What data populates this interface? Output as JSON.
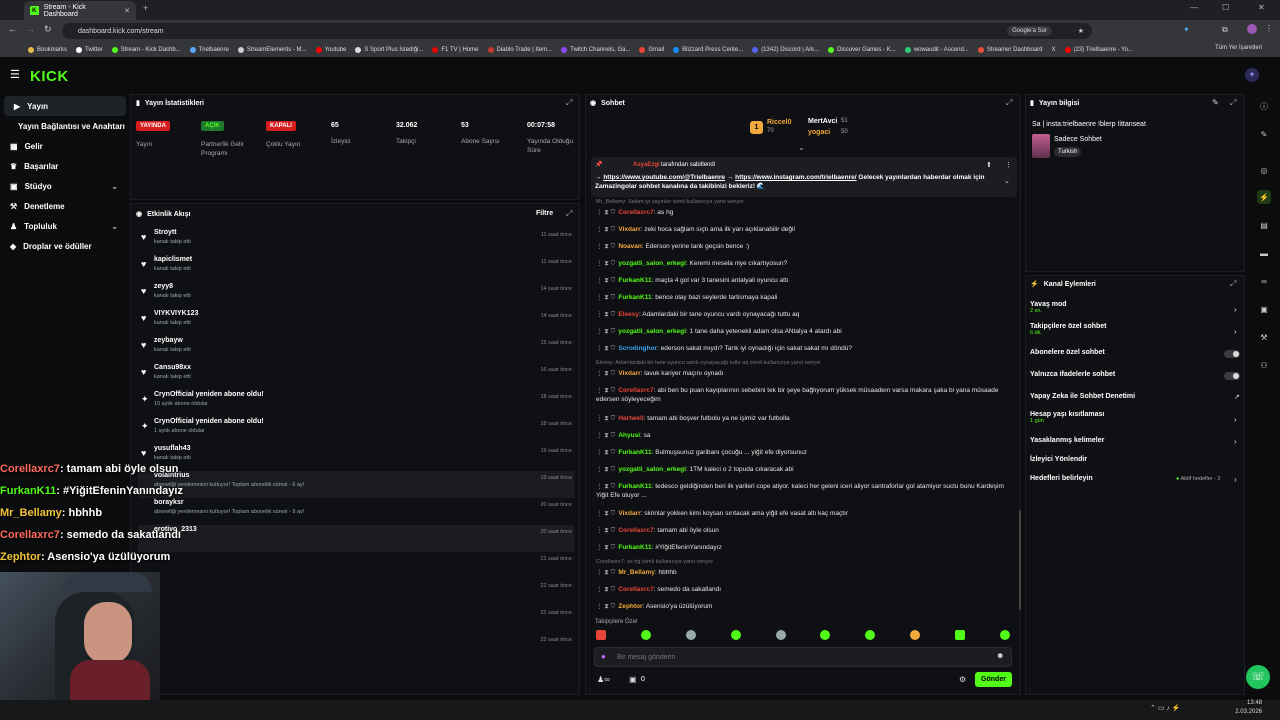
{
  "browser": {
    "tab_title": "Stream - Kick Dashboard",
    "url": "dashboard.kick.com/stream",
    "google_btn": "Google'a Sor",
    "bookmarks": [
      "Bookmarks",
      "Twitter",
      "Stream - Kick Dashb...",
      "Trielbaenre",
      "StreamElements - M...",
      "Youtube",
      "S Sport Plus İstediği...",
      "F1 TV | Home",
      "Diablo Trade | Item...",
      "Twitch Channels, Ga...",
      "Gmail",
      "Blizzard Press Cente...",
      "(1342) Discord | Ark...",
      "Discover Games - K...",
      "wowaudit - Ascend...",
      "Streamer Dashboard",
      "X",
      "(23) Trielbaenre - Yo..."
    ],
    "all_bookmarks": "Tüm Yer İşaretleri"
  },
  "brand": {
    "logo": "KICK"
  },
  "nav": {
    "items": [
      {
        "label": "Yayın",
        "chev": ""
      },
      {
        "label": "Yayın Bağlantısı ve Anahtarı",
        "chev": ""
      },
      {
        "label": "Gelir",
        "chev": ""
      },
      {
        "label": "Başarılar",
        "chev": ""
      },
      {
        "label": "Stüdyo",
        "chev": "⌄"
      },
      {
        "label": "Denetleme",
        "chev": ""
      },
      {
        "label": "Topluluk",
        "chev": "⌄"
      },
      {
        "label": "Droplar ve ödüller",
        "chev": ""
      }
    ]
  },
  "stats": {
    "title": "Yayın İstatistikleri",
    "items": [
      {
        "value": "YAYINDA",
        "label": "Yayın"
      },
      {
        "value": "AÇIK",
        "label": "Partnerlik Gelir Programı"
      },
      {
        "value": "KAPALI",
        "label": "Çoklu Yayın"
      },
      {
        "value": "65",
        "label": "İzleyici"
      },
      {
        "value": "32.062",
        "label": "Takipçi"
      },
      {
        "value": "53",
        "label": "Abone Sayısı"
      },
      {
        "value": "00:07:58",
        "label": "Yayında Olduğu Süre"
      }
    ]
  },
  "activity": {
    "title": "Etkinlik Akışı",
    "filter": "Filtre",
    "items": [
      {
        "icon": "♥",
        "name": "Stroytt",
        "sub": "kanalı takip etti",
        "time": "11 saat önce"
      },
      {
        "icon": "♥",
        "name": "kapiclismet",
        "sub": "kanalı takip etti",
        "time": "11 saat önce"
      },
      {
        "icon": "♥",
        "name": "zeyy8",
        "sub": "kanalı takip etti",
        "time": "14 saat önce"
      },
      {
        "icon": "♥",
        "name": "VIYKVIYK123",
        "sub": "kanalı takip etti",
        "time": "14 saat önce"
      },
      {
        "icon": "♥",
        "name": "zeybayw",
        "sub": "kanalı takip etti",
        "time": "15 saat önce"
      },
      {
        "icon": "♥",
        "name": "Cansu98xx",
        "sub": "kanalı takip etti",
        "time": "16 saat önce"
      },
      {
        "icon": "✦",
        "name": "CrynOfficial yeniden abone oldu!",
        "sub": "10 aylık abone oldular",
        "time": "18 saat önce"
      },
      {
        "icon": "✦",
        "name": "CrynOfficial yeniden abone oldu!",
        "sub": "1 aylık abone oldular",
        "time": "18 saat önce"
      },
      {
        "icon": "♥",
        "name": "yusuflah43",
        "sub": "kanalı takip etti",
        "time": "19 saat önce"
      },
      {
        "icon": "",
        "name": "volaintrius",
        "sub": "aboneliği yenilemesini kutluyor! Toplam abonelik süresi - 6 ay!",
        "time": "19 saat önce"
      },
      {
        "icon": "",
        "name": "borayksr",
        "sub": "aboneliği yenilemesini kutluyor! Toplam abonelik süresi - 9 ay!",
        "time": "20 saat önce"
      },
      {
        "icon": "",
        "name": "erotivo_2313",
        "sub": "",
        "time": "20 saat önce"
      },
      {
        "icon": "",
        "name": "",
        "sub": "",
        "time": "21 saat önce"
      },
      {
        "icon": "",
        "name": "",
        "sub": "",
        "time": "22 saat önce"
      },
      {
        "icon": "",
        "name": "",
        "sub": "",
        "time": "22 saat önce"
      },
      {
        "icon": "",
        "name": "",
        "sub": "",
        "time": "22 saat önce"
      }
    ]
  },
  "chat": {
    "title": "Sohbet",
    "top": [
      {
        "name": "Riccel0",
        "count": "70"
      },
      {
        "name": "MertAvci",
        "count": "51"
      },
      {
        "name": "yogaci",
        "count": "50"
      }
    ],
    "pinned": {
      "by": "AsyaEzgi",
      "by_text": "tarafından sabitlendi",
      "text_pre": "→",
      "link1": "https://www.youtube.com/@Trielbaenre",
      "mid": "→",
      "link2": "https://www.instagram.com/trielbaenre/",
      "text_post": "Gelecek yayınlardan haberdar olmak için Zamazingolar sohbet kanalına da takibinizi bekleriz! 🌊"
    },
    "messages": [
      {
        "reply": "Mr_Bellamy: Selam iyi yayınlar isimli kullanıcıya yanıt veriyor",
        "user": "Corellaxrc7",
        "color": "#e8443a",
        "text": "as hg"
      },
      {
        "reply": "",
        "user": "Vixdarr",
        "color": "#f2a93b",
        "text": "zeki hoca sağlam sıçtı ama ilk yarı açıklanabilir değil"
      },
      {
        "reply": "",
        "user": "Noavan",
        "color": "#f2a93b",
        "text": "Ederson yerine tank geçsin bence :)"
      },
      {
        "reply": "",
        "user": "yozgatli_salon_erkegi",
        "color": "#53fc18",
        "text": "Keremi mesela niye cıkartıyosun?"
      },
      {
        "reply": "",
        "user": "FurkanK11",
        "color": "#53fc18",
        "text": "maçta 4 gol var 3 tanesini antalyali oyuncu attı"
      },
      {
        "reply": "",
        "user": "FurkanK11",
        "color": "#53fc18",
        "text": "bence olay bazi seylerde tartismaya kapali"
      },
      {
        "reply": "",
        "user": "Eleesy",
        "color": "#e8443a",
        "text": "Adamlardaki bir tane oyuncu vardı oynayacağı tuttu aq"
      },
      {
        "reply": "",
        "user": "yozgatli_salon_erkegi",
        "color": "#53fc18",
        "text": "1 tane daha yetenekli adam olsa ANtalya 4 atardı abi"
      },
      {
        "reply": "",
        "user": "Scrodinghor",
        "color": "#3ba4f2",
        "text": "ederson sakat mıydı? Tarık iyi oynadığı için sakat sakat mı döndü?"
      },
      {
        "reply": "Eleesy: Adamlardaki bir tane oyuncu vardı oynayacağı tuttu aq isimli kullanıcıya yanıt veriyor",
        "user": "Vixdarr",
        "color": "#f2a93b",
        "text": "lavuk kariyer maçını oynadı"
      },
      {
        "reply": "",
        "user": "Corellaxrc7",
        "color": "#e8443a",
        "text": "abi ben bu puan kayıplarının sebebini tek bir şeye bağlıyorum yüksek müsaadeın varsa makara şaka bi yana müsaade edersen söyleyeceğim"
      },
      {
        "reply": "",
        "user": "Hartwell",
        "color": "#e8443a",
        "text": "tamam abi boşver futbolu ya ne işimiz var futbolla"
      },
      {
        "reply": "",
        "user": "Ahyusi",
        "color": "#53fc18",
        "text": "sa"
      },
      {
        "reply": "",
        "user": "FurkanK11",
        "color": "#53fc18",
        "text": "Bulmuşsunuz garibanı çocuğu ... yiğit efe diyorsunuz"
      },
      {
        "reply": "",
        "user": "yozgatli_salon_erkegi",
        "color": "#53fc18",
        "text": "1TM kaleci o 2 topuda cıkaracak abi"
      },
      {
        "reply": "",
        "user": "FurkanK11",
        "color": "#53fc18",
        "text": "tedesco geldiğinden beri ilk yarileri cope atiyor. kaleci her geleni iceri aliyor santraforlar gol atamiyor suclu bunu Kardeşim Yiğit Efe oluyor ..."
      },
      {
        "reply": "",
        "user": "Vixdarr",
        "color": "#f2a93b",
        "text": "skrinlar yokken kimi koysan sırıtacak ama yiğit efe vasat altı kaç maçtır"
      },
      {
        "reply": "",
        "user": "Corellaxrc7",
        "color": "#e8443a",
        "text": "tamam abi öyle olsun"
      },
      {
        "reply": "",
        "user": "FurkanK11",
        "color": "#53fc18",
        "text": "#YiğitEfeninYanındayız"
      },
      {
        "reply": "Corellaxrc7: as hg isimli kullanıcıya yanıt veriyor",
        "user": "Mr_Bellamy",
        "color": "#f2a93b",
        "text": "hbhhb"
      },
      {
        "reply": "",
        "user": "Corellaxrc7",
        "color": "#e8443a",
        "text": "semedo da sakatlandı"
      },
      {
        "reply": "",
        "user": "Zephtor",
        "color": "#f2a93b",
        "text": "Asensio'ya üzülüyorum"
      }
    ],
    "followers_only": "Takipçilere Özel",
    "placeholder": "Bir mesaj gönderin",
    "send": "Gönder",
    "zero": "0"
  },
  "info": {
    "title": "Yayın bilgisi",
    "stream_title": "Sa | insta:trielbaenre !blerp !ittanseat",
    "category": "Sadece Sohbet",
    "tag": "Turkish"
  },
  "actions": {
    "title": "Kanal Eylemleri",
    "items": [
      {
        "label": "Yavaş mod",
        "sub": "2 sn."
      },
      {
        "label": "Takipçilere özel sohbet",
        "sub": "6 dk."
      },
      {
        "label": "Abonelere özel sohbet",
        "sub": ""
      },
      {
        "label": "Yalnızca ifadelerle sohbet",
        "sub": ""
      },
      {
        "label": "Yapay Zeka ile Sohbet Denetimi",
        "sub": ""
      },
      {
        "label": "Hesap yaşı kısıtlaması",
        "sub": "1 gün"
      },
      {
        "label": "Yasaklanmış kelimeler",
        "sub": ""
      },
      {
        "label": "İzleyici Yönlendir",
        "sub": ""
      },
      {
        "label": "Hedefleri belirleyin",
        "sub": ""
      }
    ],
    "goal_status": "Aktif hedefler - 2"
  },
  "overlay": [
    {
      "user": "Corellaxrc7",
      "color": "#ff6a5e",
      "text": ": tamam abi öyle olsun"
    },
    {
      "user": "FurkanK11",
      "color": "#53fc18",
      "text": ": #YiğitEfeninYanındayız"
    },
    {
      "user": "Mr_Bellamy",
      "color": "#f2c53b",
      "text": ": hbhhb"
    },
    {
      "user": "Corellaxrc7",
      "color": "#ff6a5e",
      "text": ": semedo da sakatlandı"
    },
    {
      "user": "Zephtor",
      "color": "#f2c53b",
      "text": ": Asensio'ya üzülüyorum"
    }
  ],
  "taskbar": {
    "time": "13:48",
    "date": "2.03.2026"
  }
}
